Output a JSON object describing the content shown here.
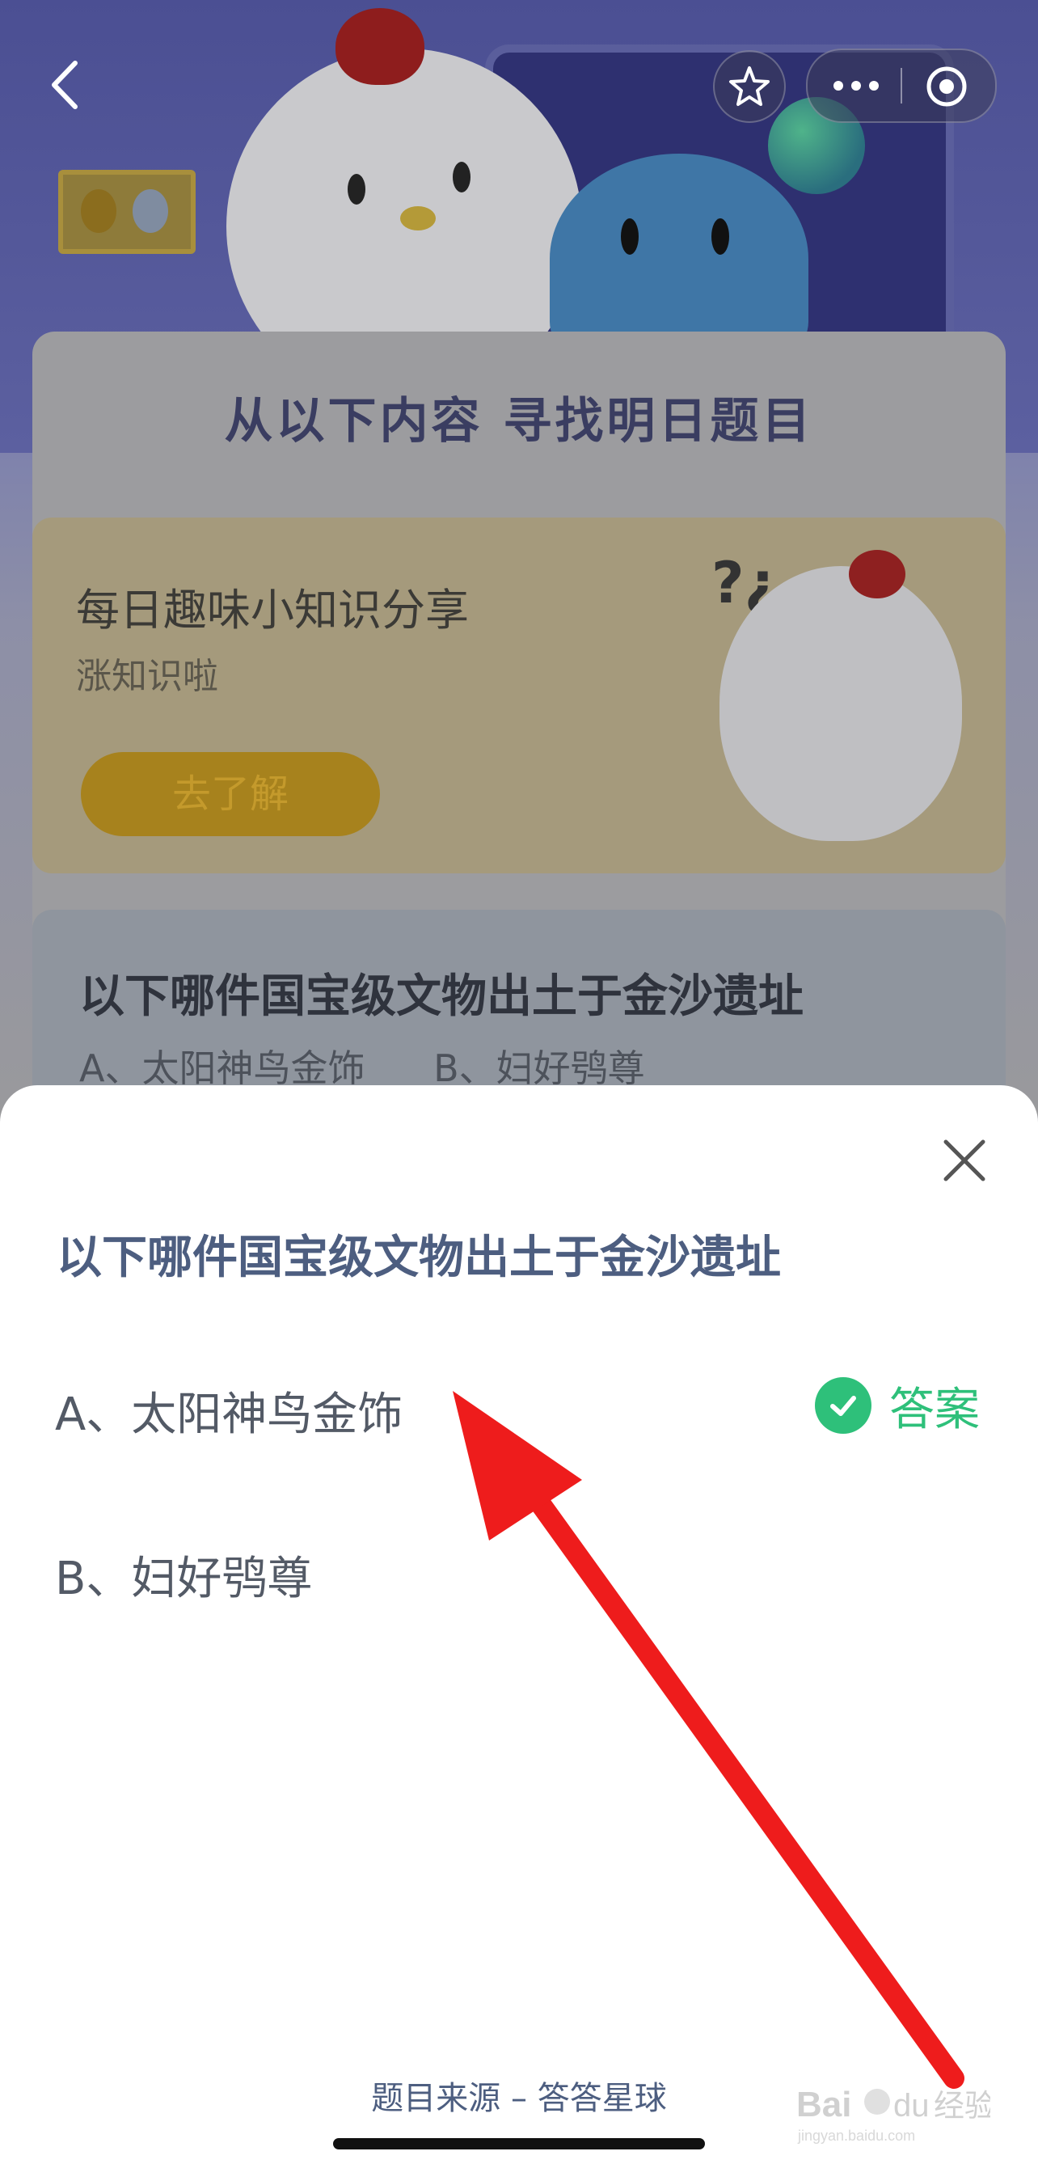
{
  "background": {
    "header_title": "从以下内容 寻找明日题目",
    "card_knowledge": {
      "title": "每日趣味小知识分享",
      "subtitle": "涨知识啦",
      "button": "去了解"
    },
    "card_question": {
      "title": "以下哪件国宝级文物出土于金沙遗址",
      "options": [
        "A、太阳神鸟金饰",
        "B、妇好鸮尊"
      ]
    }
  },
  "nav": {
    "icons": [
      "back-icon",
      "star-icon",
      "more-icon",
      "record-icon"
    ]
  },
  "sheet": {
    "question": "以下哪件国宝级文物出土于金沙遗址",
    "option_a": "A、太阳神鸟金饰",
    "option_b": "B、妇好鸮尊",
    "answer_label": "答案",
    "source": "题目来源 – 答答星球"
  },
  "watermark": {
    "text": "Bai du 经验",
    "url": "jingyan.baidu.com"
  },
  "colors": {
    "accent_green": "#2ec07a",
    "title_blue": "#4d5e80",
    "arrow_red": "#ee1c1c"
  }
}
